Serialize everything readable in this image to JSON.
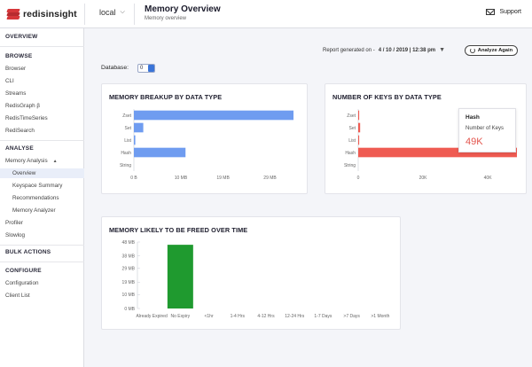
{
  "app": {
    "logo_text": "redisinsight",
    "instance": "local"
  },
  "header": {
    "title": "Memory Overview",
    "subtitle": "Memory overview",
    "support_label": "Support"
  },
  "sidebar": {
    "overview": "OVERVIEW",
    "browse_head": "BROWSE",
    "browse_items": [
      "Browser",
      "CLI",
      "Streams",
      "RedisGraph β",
      "RedisTimeSeries",
      "RediSearch"
    ],
    "analyse_head": "ANALYSE",
    "memory_analysis": "Memory Analysis",
    "memory_sub": [
      "Overview",
      "Keyspace Summary",
      "Recommendations",
      "Memory Analyzer"
    ],
    "analyse_items": [
      "Profiler",
      "Slowlog"
    ],
    "bulk_actions": "BULK ACTIONS",
    "configure_head": "CONFIGURE",
    "configure_items": [
      "Configuration",
      "Client List"
    ]
  },
  "report": {
    "prefix": "Report generated on -",
    "date": "4 / 10 / 2019 | 12:38 pm",
    "analyze_label": "Analyze Again"
  },
  "database": {
    "label": "Database:",
    "value": "0"
  },
  "chart_data": [
    {
      "type": "bar",
      "orientation": "horizontal",
      "title": "MEMORY BREAKUP BY DATA TYPE",
      "categories": [
        "Zset",
        "Set",
        "List",
        "Hash",
        "String"
      ],
      "values": [
        34,
        2,
        0.3,
        11,
        0
      ],
      "tick_labels": [
        "0 B",
        "10 MB",
        "19 MB",
        "29 MB"
      ],
      "ticks": [
        0,
        10,
        19,
        29
      ],
      "xlim": [
        0,
        34
      ],
      "unit": "MB",
      "color": "#6f9cf0"
    },
    {
      "type": "bar",
      "orientation": "horizontal",
      "title": "NUMBER OF KEYS BY DATA TYPE",
      "categories": [
        "Zset",
        "Set",
        "List",
        "Hash",
        "String"
      ],
      "values": [
        300,
        600,
        300,
        49000,
        0
      ],
      "tick_labels": [
        "0",
        "20K",
        "40K"
      ],
      "ticks": [
        0,
        20000,
        40000
      ],
      "xlim": [
        0,
        49000
      ],
      "color": "#ef5b52",
      "tooltip": {
        "title": "Hash",
        "label": "Number of Keys",
        "value": "49K"
      }
    },
    {
      "type": "bar",
      "title": "MEMORY LIKELY TO BE FREED OVER TIME",
      "categories": [
        "Already Expired",
        "No Expiry",
        "<1hr",
        "1-4 Hrs",
        "4-12 Hrs",
        "12-24 Hrs",
        "1-7 Days",
        ">7 Days",
        ">1 Month"
      ],
      "values": [
        0,
        46,
        0,
        0,
        0,
        0,
        0,
        0,
        0
      ],
      "tick_labels": [
        "0 MB",
        "10 MB",
        "19 MB",
        "29 MB",
        "38 MB",
        "48 MB"
      ],
      "ticks": [
        0,
        10,
        19,
        29,
        38,
        48
      ],
      "ylim": [
        0,
        48
      ],
      "unit": "MB",
      "color": "#1f9a2f"
    }
  ]
}
